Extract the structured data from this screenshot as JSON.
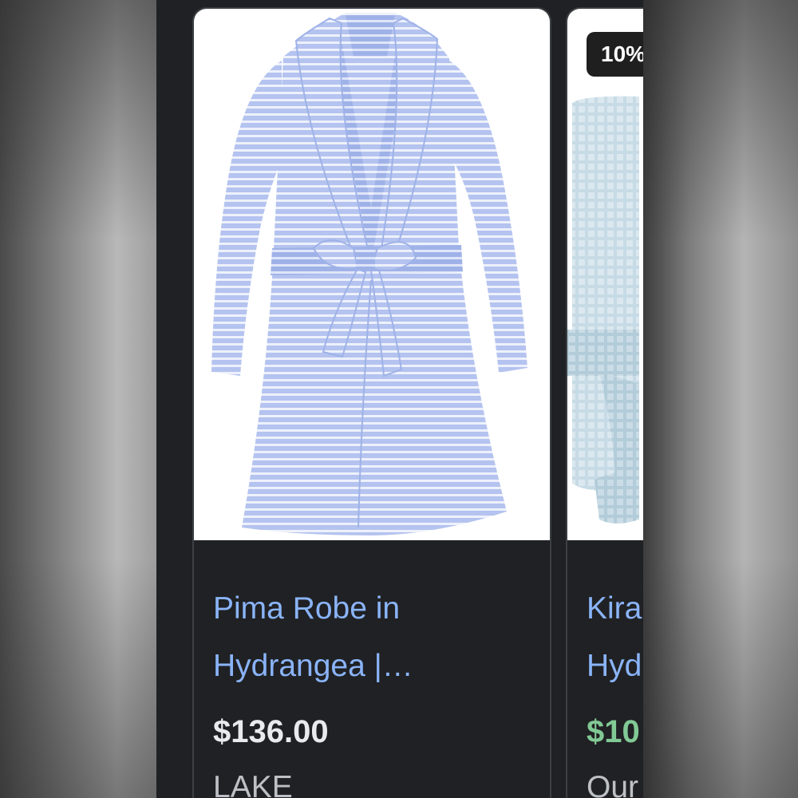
{
  "cards": [
    {
      "title_line1": "Pima Robe in",
      "title_line2": "Hydrangea |…",
      "price": "$136.00",
      "store": "LAKE",
      "image": "blue-striped-robe"
    },
    {
      "badge": "10%",
      "title_line1": "Kira",
      "title_line2": "Hyd",
      "price": "$10",
      "store": "Our",
      "image": "light-blue-waffle-robe"
    }
  ],
  "colors": {
    "screen_background": "#202124",
    "title_link": "#8ab4f8",
    "price": "#e8eaed",
    "sale_price": "#81c995",
    "store": "#bdc1c6"
  }
}
